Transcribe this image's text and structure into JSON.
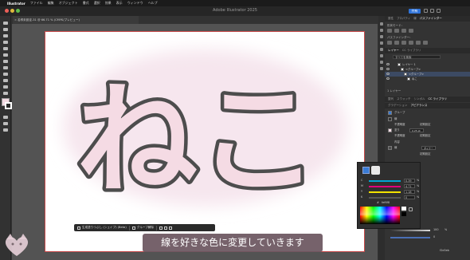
{
  "menubar": {
    "app": "Illustrator",
    "items": [
      "ファイル",
      "編集",
      "オブジェクト",
      "書式",
      "選択",
      "効果",
      "表示",
      "ウィンドウ",
      "ヘルプ"
    ]
  },
  "window": {
    "title": "Adobe Illustrator 2025",
    "share_label": "共有"
  },
  "document_tab": {
    "title": "名称未設定-31 @ 66.71 % (CMYK/プレビュー)"
  },
  "artwork": {
    "text": "ねこ",
    "fill_color": "#f5dbe4",
    "stroke_color": "#4d4d4d",
    "glow_color": "#f7e8ef"
  },
  "taskbar": {
    "label": "生成塗りつぶし (シェイプ) (Beta)",
    "group_label": "グループ解除"
  },
  "subtitle": {
    "text": "線を好きな色に変更していきます"
  },
  "panels": {
    "top_tabs": [
      "属性",
      "プロパティ",
      "線",
      "パスファインダー"
    ],
    "top_tab_active": "パスファインダー",
    "shape_mode_label": "形状モード：",
    "pathfinder_label": "パスファインダー：",
    "layers_tabs": [
      "レイヤー",
      "CC ライブラリ"
    ],
    "layers_search_placeholder": "すべてを検索",
    "layers": [
      {
        "name": "レイヤー 1",
        "selected": false
      },
      {
        "name": "<グループ>",
        "selected": false
      },
      {
        "name": "<グループ>",
        "selected": true
      },
      {
        "name": "ねこ",
        "selected": false
      }
    ],
    "layers_footer": "1 レイヤー",
    "mid_tabs": [
      "整列",
      "スウォッチ",
      "シンボル",
      "CC ライブラリ",
      "カラーガイド",
      "アピアランス"
    ],
    "appearance_tabs": [
      "グラデーション",
      "アピアランス"
    ],
    "appearance_group": "グループ",
    "appearance_rows": [
      "線",
      "不透明度",
      "塗り",
      "不透明度",
      "内容",
      "線"
    ],
    "appearance_values": [
      "",
      "初期設定",
      "0.25 pt",
      "初期設定",
      "",
      "ダイナー"
    ],
    "appearance_opacity_default": "初期設定"
  },
  "color_picker": {
    "rows": [
      {
        "label": "C",
        "value": "0.39",
        "unit": "%",
        "track_color": "#00a6d6"
      },
      {
        "label": "M",
        "value": "4.71",
        "unit": "%",
        "track_color": "#e0007a"
      },
      {
        "label": "Y",
        "value": "1.18",
        "unit": "%",
        "track_color": "#f2e200"
      },
      {
        "label": "K",
        "value": "0",
        "unit": "%",
        "track_color": "#555555"
      }
    ],
    "hex": "fef6f8",
    "lower_values": [
      "100",
      "0"
    ],
    "lower_unit": "%",
    "footer_value": "f2e3eb"
  }
}
